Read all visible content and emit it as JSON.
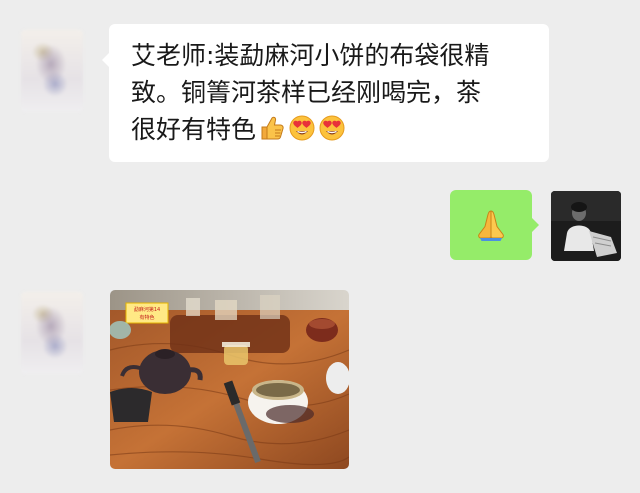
{
  "messages": [
    {
      "side": "left",
      "type": "text",
      "lines": [
        "艾老师:装勐麻河小饼的布袋很精",
        "致。铜箐河茶样已经刚喝完，茶",
        "很好有特色"
      ],
      "trailing_emojis": [
        "thumbs-up-icon",
        "heart-eyes-icon",
        "heart-eyes-icon"
      ]
    },
    {
      "side": "right",
      "type": "emoji",
      "emoji": "folded-hands-icon"
    },
    {
      "side": "left",
      "type": "image",
      "image_caption": "勐麻河第14\n有特色"
    }
  ],
  "colors": {
    "background": "#ededed",
    "incoming_bubble": "#ffffff",
    "outgoing_bubble": "#95ec69",
    "text": "#191919"
  }
}
